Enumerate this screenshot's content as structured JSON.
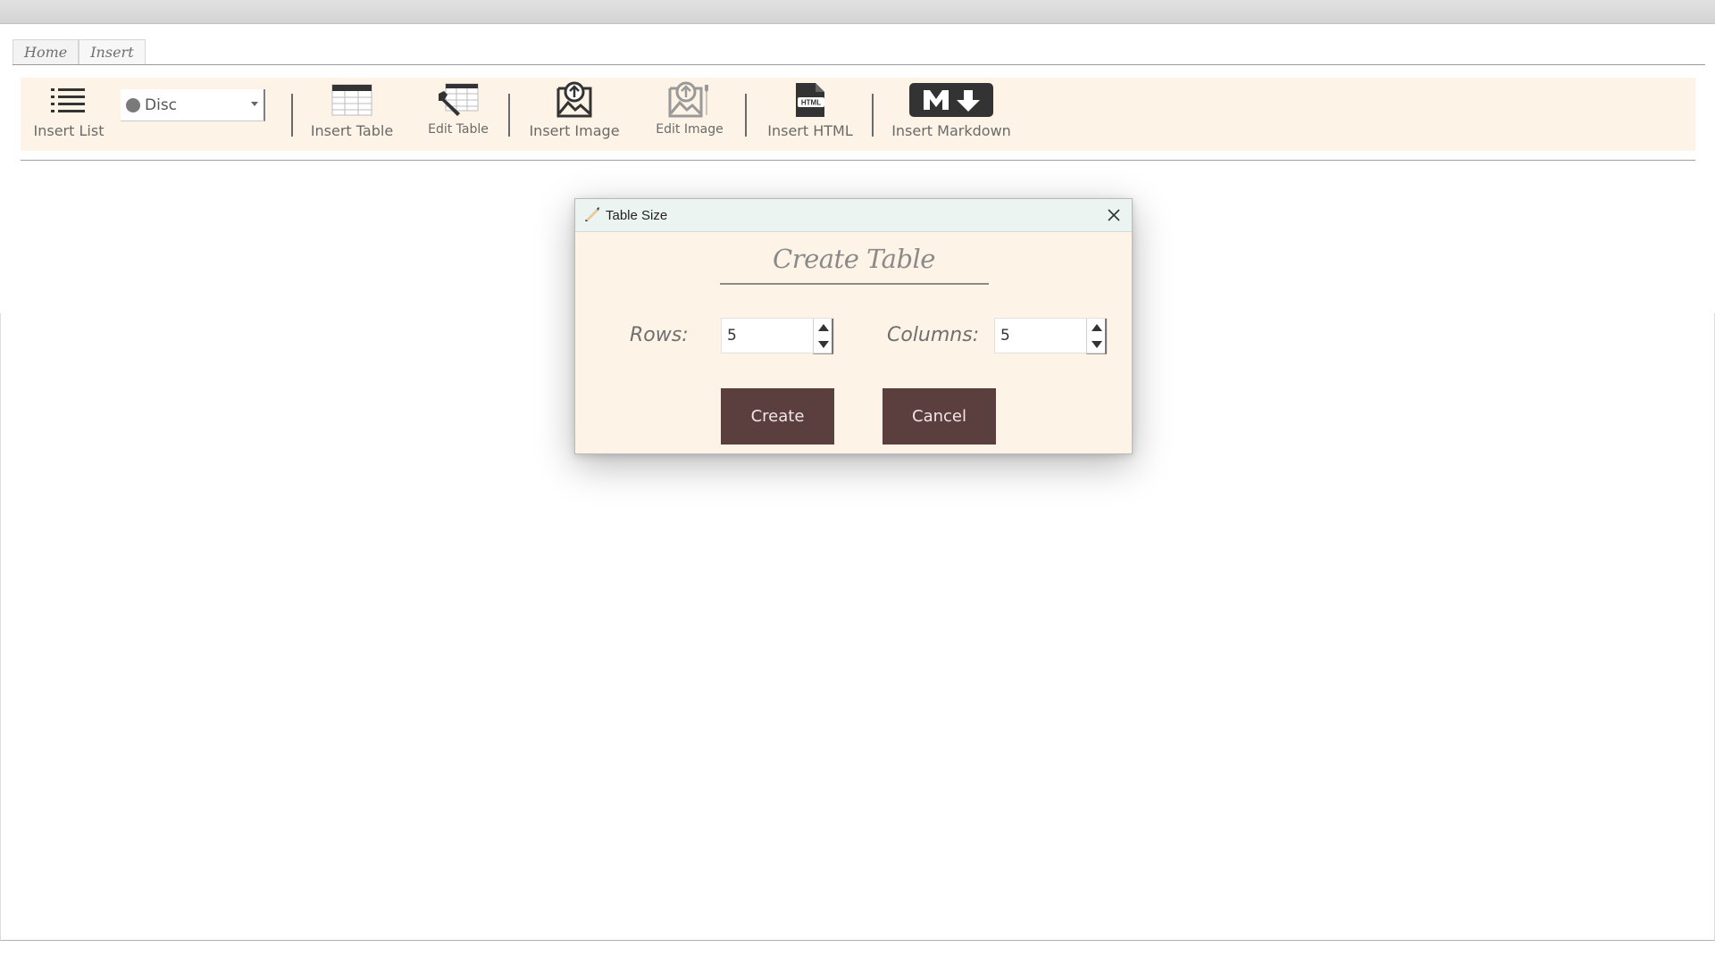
{
  "tabs": [
    {
      "label": "Home"
    },
    {
      "label": "Insert"
    }
  ],
  "ribbon": {
    "insert_list": "Insert List",
    "list_style": {
      "selected": "Disc"
    },
    "insert_table": "Insert Table",
    "edit_table": "Edit Table",
    "insert_image": "Insert Image",
    "edit_image": "Edit Image",
    "insert_html": "Insert HTML",
    "insert_markdown": "Insert Markdown"
  },
  "dialog": {
    "title": "Table Size",
    "heading": "Create Table",
    "rows_label": "Rows:",
    "rows_value": "5",
    "columns_label": "Columns:",
    "columns_value": "5",
    "create_label": "Create",
    "cancel_label": "Cancel"
  },
  "icons": {
    "list": "list-icon",
    "table": "table-icon",
    "edit_table": "edit-table-icon",
    "image": "image-upload-icon",
    "edit_image": "edit-image-icon",
    "html": "html-file-icon",
    "markdown": "markdown-icon",
    "close": "close-icon"
  },
  "colors": {
    "ribbon_bg": "#fdf3e6",
    "button_bg": "#5b3e3e",
    "dialog_title_bg": "#ecf4f2"
  }
}
